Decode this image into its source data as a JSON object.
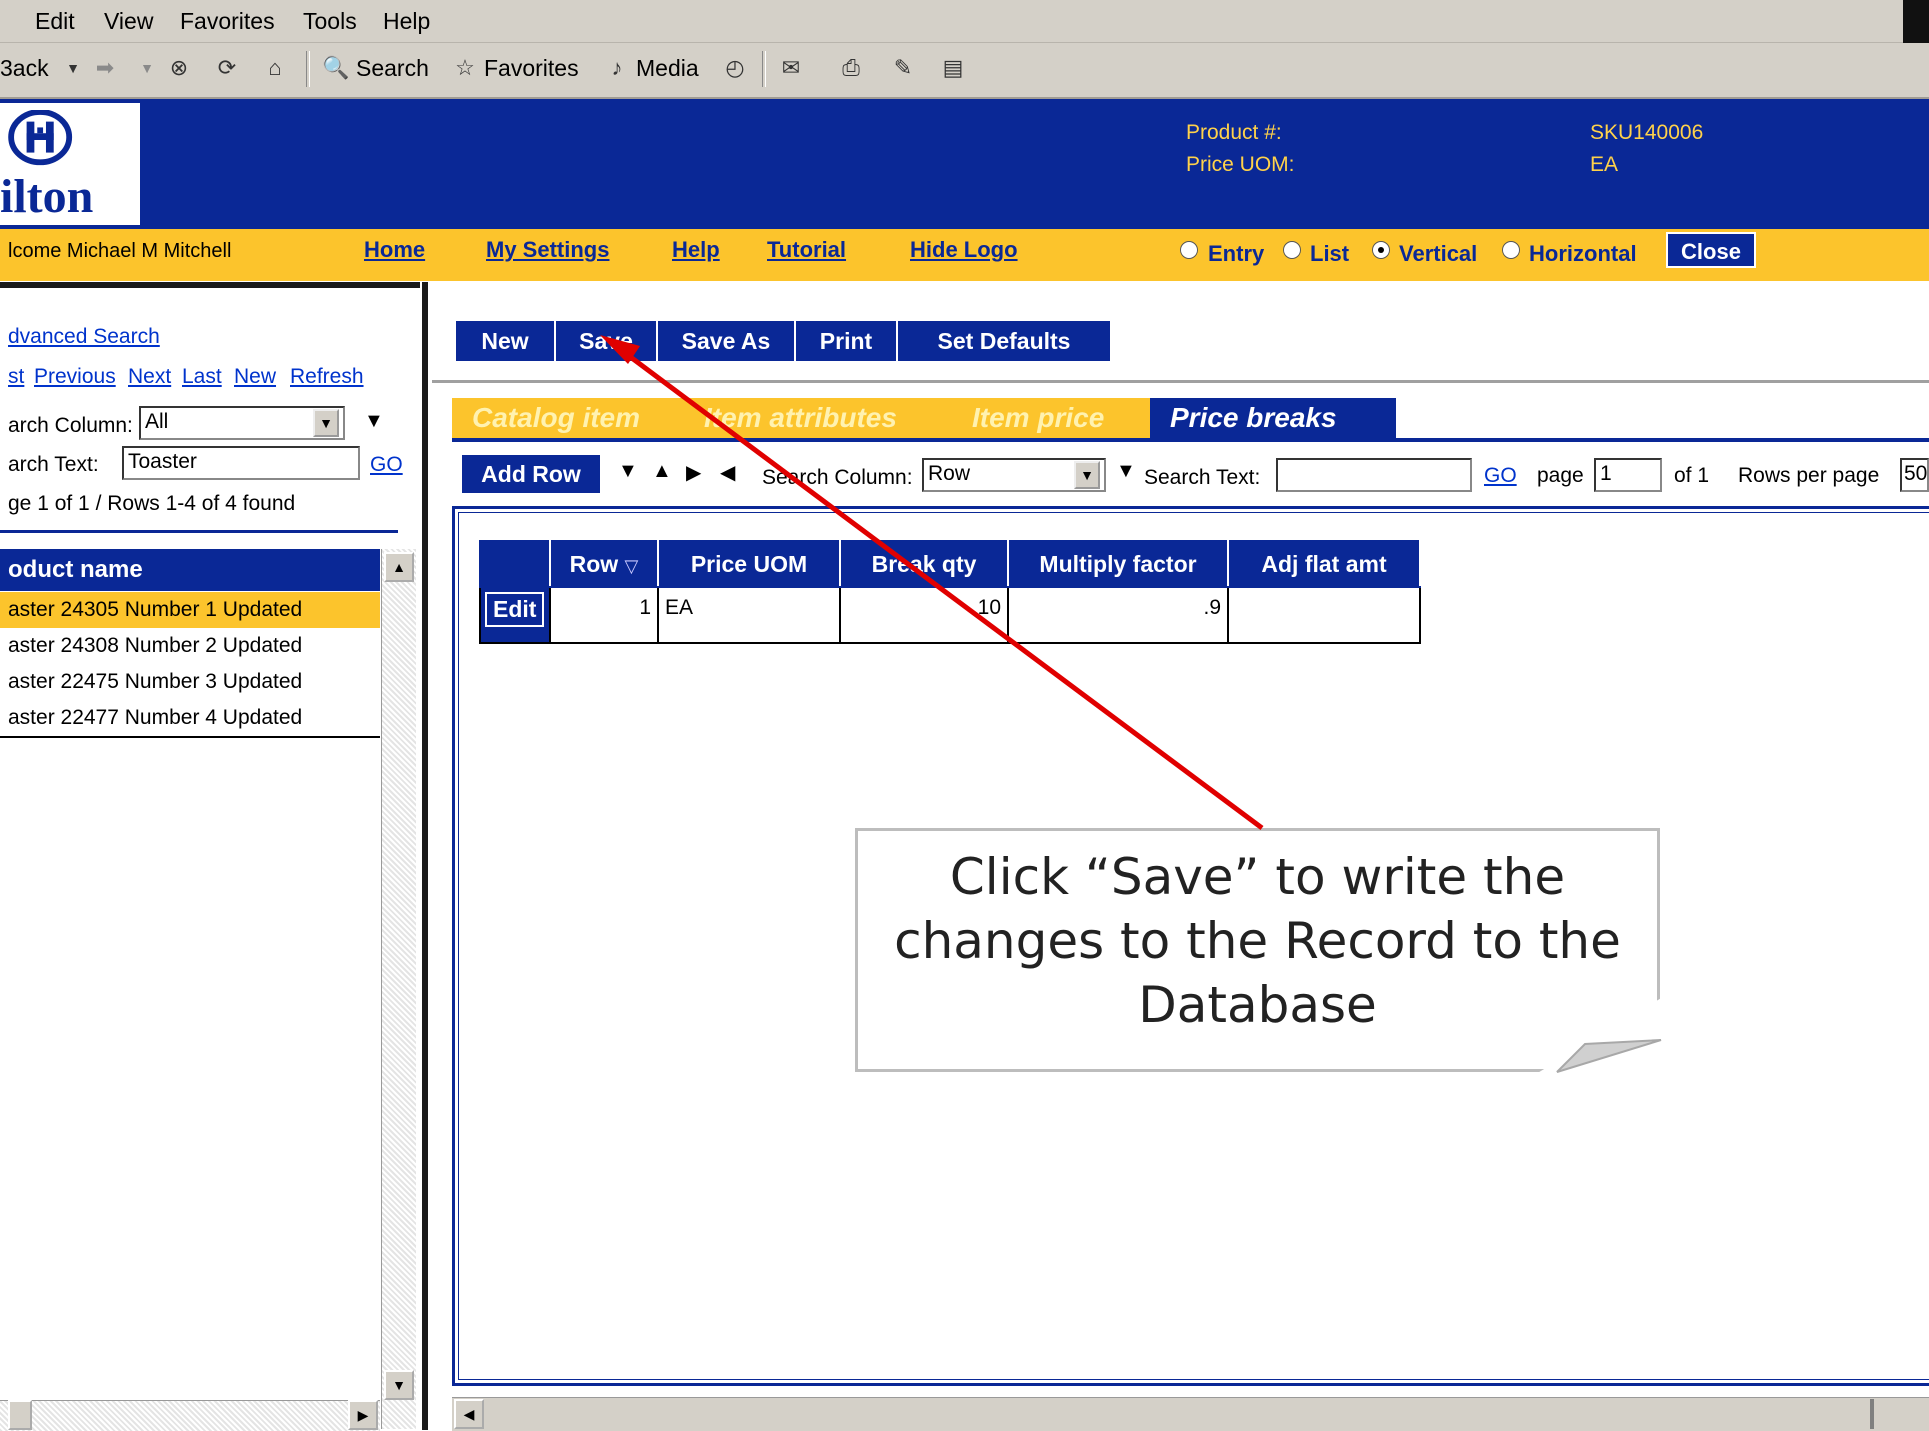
{
  "menu": [
    "Edit",
    "View",
    "Favorites",
    "Tools",
    "Help"
  ],
  "toolbar": {
    "back": "3ack",
    "search": "Search",
    "favorites": "Favorites",
    "media": "Media"
  },
  "header": {
    "logo_text": "ilton",
    "product_label": "Product #:",
    "product_value": "SKU140006",
    "uom_label": "Price UOM:",
    "uom_value": "EA"
  },
  "nav": {
    "welcome": "lcome Michael M Mitchell",
    "links": [
      "Home",
      "My Settings",
      "Help",
      "Tutorial",
      "Hide Logo"
    ],
    "views": [
      {
        "label": "Entry",
        "selected": false
      },
      {
        "label": "List",
        "selected": false
      },
      {
        "label": "Vertical",
        "selected": true
      },
      {
        "label": "Horizontal",
        "selected": false
      }
    ],
    "close": "Close"
  },
  "left": {
    "advanced_search": "dvanced Search",
    "nav_links": [
      "st",
      "Previous",
      "Next",
      "Last",
      "New",
      "Refresh"
    ],
    "search_column_label": "arch Column:",
    "search_column_value": "All",
    "search_text_label": "arch Text:",
    "search_text_value": "Toaster",
    "go": "GO",
    "page_info": "ge 1 of 1 / Rows 1-4 of 4 found",
    "list_header": "oduct name",
    "items": [
      "aster 24305 Number 1 Updated",
      "aster 24308 Number 2 Updated",
      "aster 22475 Number 3 Updated",
      "aster 22477 Number 4 Updated"
    ]
  },
  "actions": [
    "New",
    "Save",
    "Save As",
    "Print",
    "Set Defaults"
  ],
  "tabs": [
    "Catalog item",
    "Item attributes",
    "Item price",
    "Price breaks"
  ],
  "grid_toolbar": {
    "add_row": "Add Row",
    "search_column_label": "Search Column:",
    "search_column_value": "Row",
    "search_text_label": "Search Text:",
    "search_text_value": "",
    "go": "GO",
    "page_label": "page",
    "page_value": "1",
    "of_label": "of 1",
    "rows_per_page_label": "Rows per page",
    "rows_per_page_value": "50"
  },
  "grid": {
    "columns": [
      "",
      "Row",
      "Price UOM",
      "Break qty",
      "Multiply factor",
      "Adj flat amt"
    ],
    "sort_indicator": "▽",
    "rows": [
      {
        "edit": "Edit",
        "row": "1",
        "uom": "EA",
        "qty": "10",
        "factor": ".9",
        "adj": ""
      }
    ]
  },
  "callout": {
    "text": "Click “Save” to write the changes to the Record to the Database"
  },
  "colors": {
    "brand_blue": "#0a2896",
    "brand_yellow": "#fcc42c",
    "arrow_red": "#e00000"
  }
}
